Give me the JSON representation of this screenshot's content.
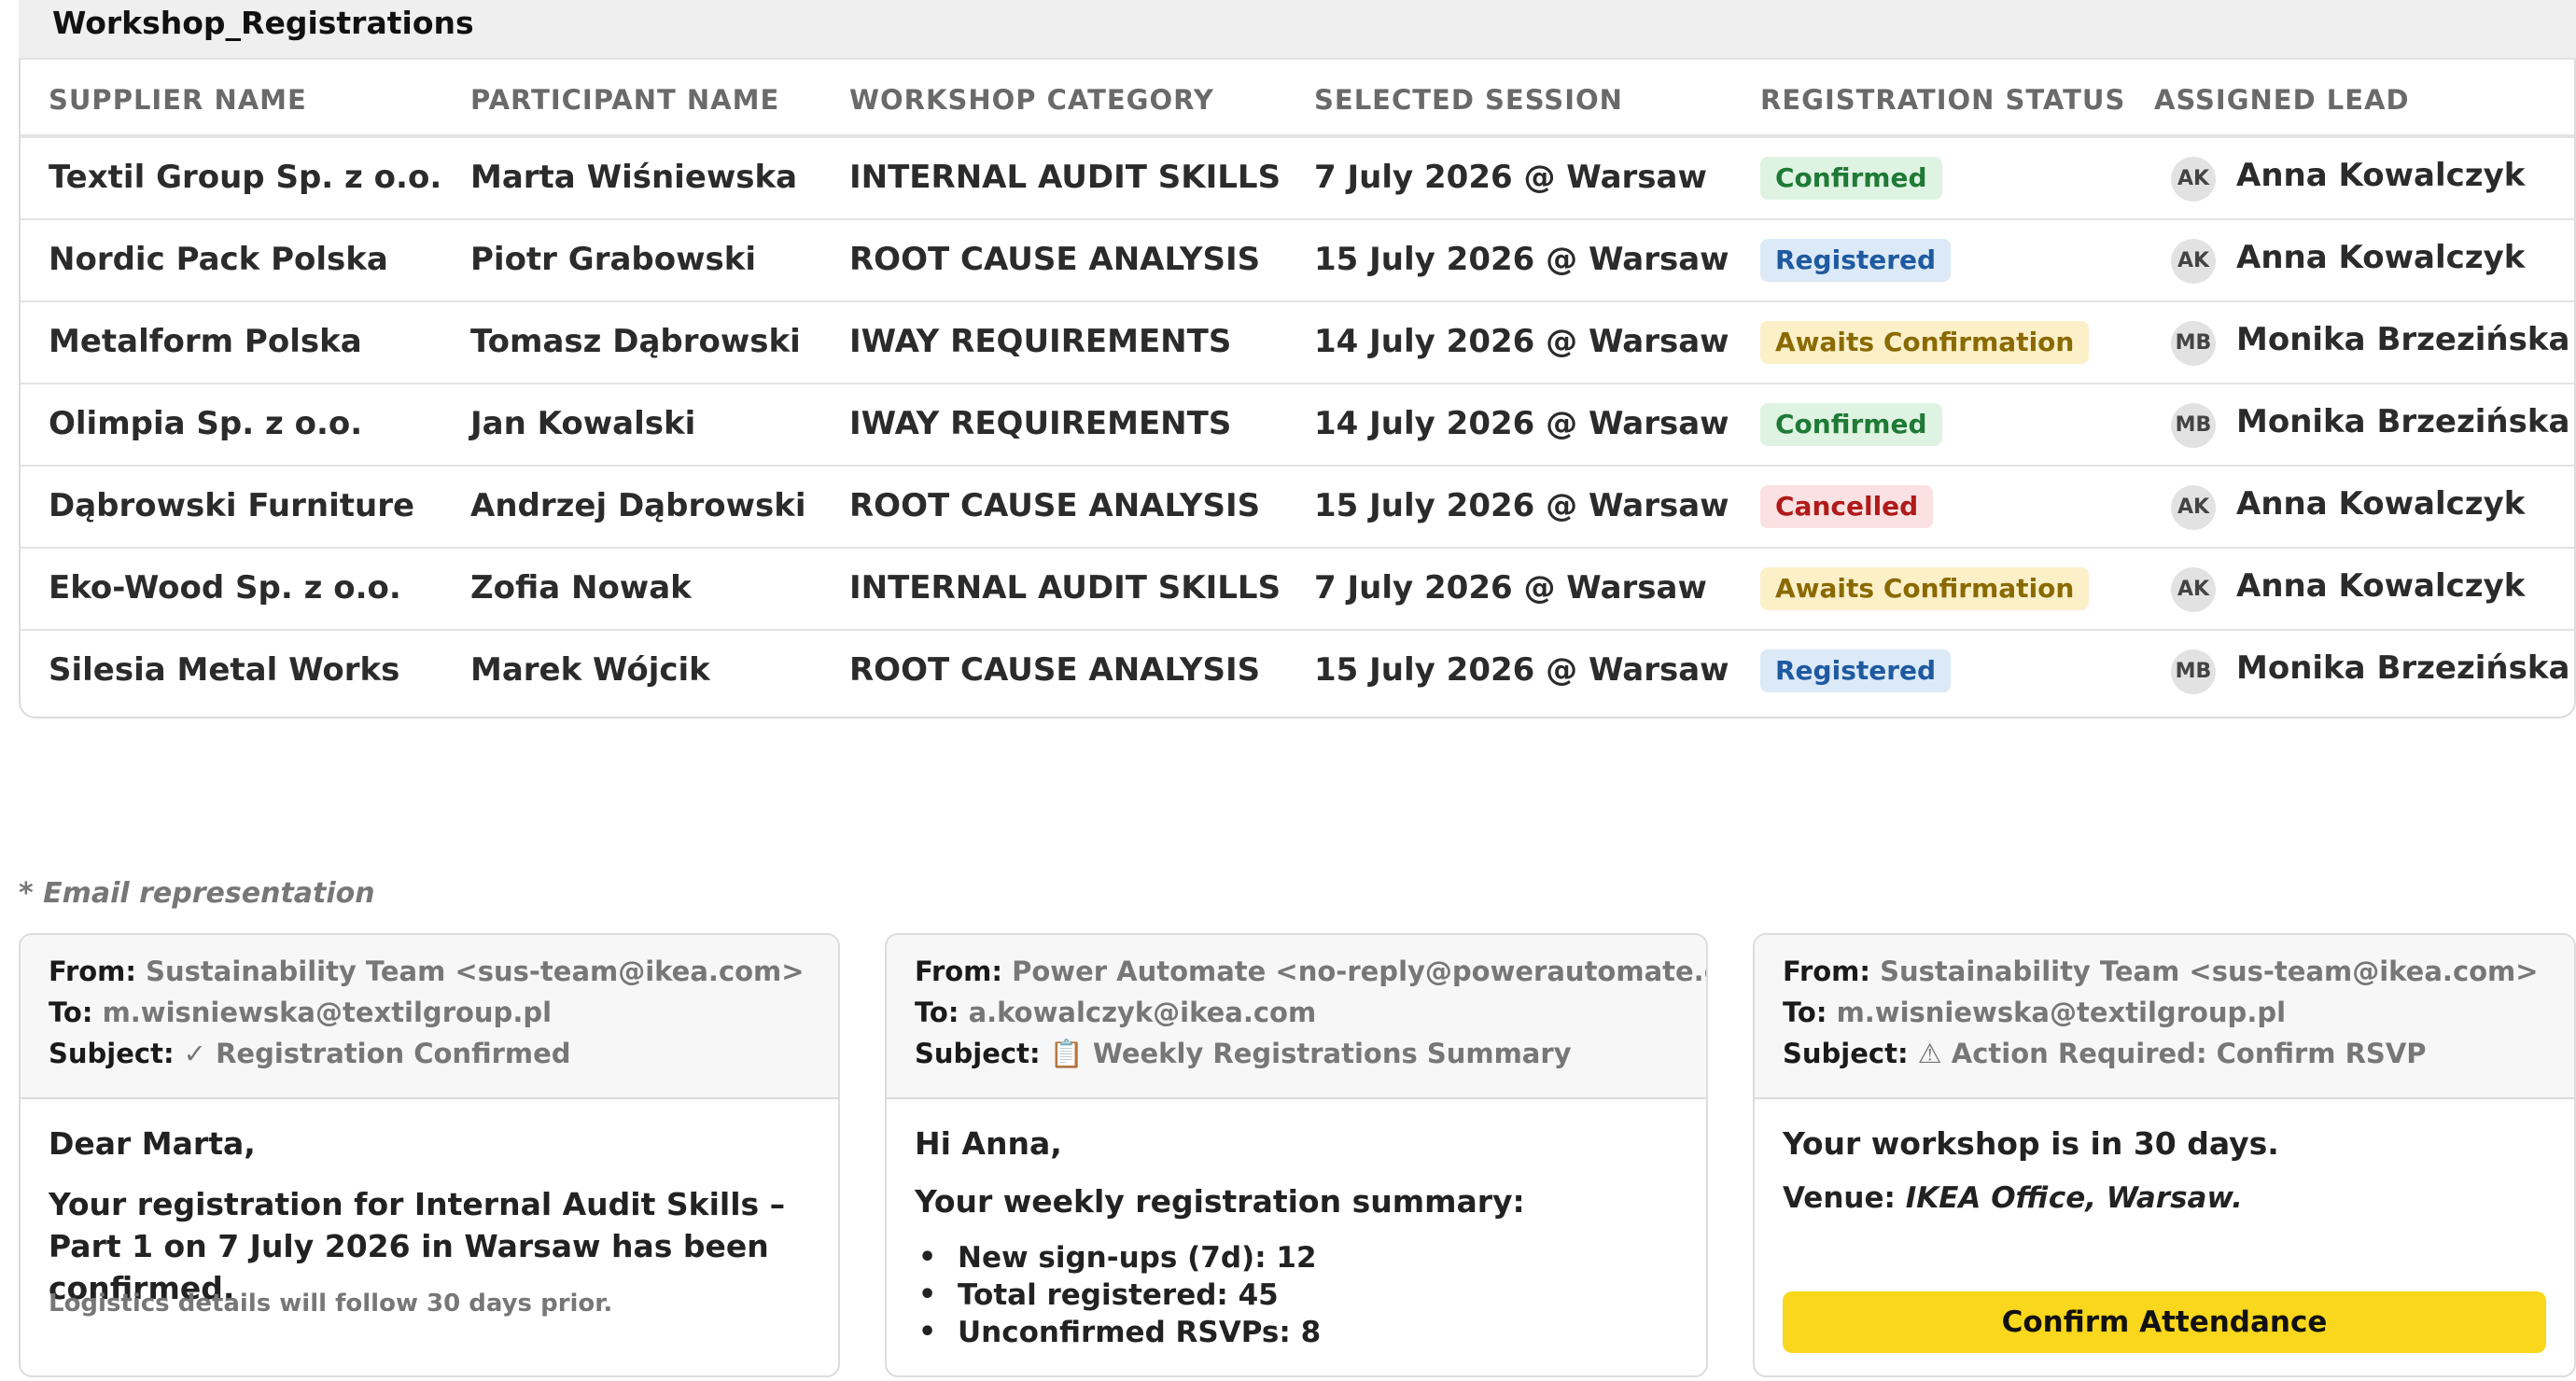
{
  "table": {
    "title": "Workshop_Registrations",
    "columns": [
      "SUPPLIER NAME",
      "PARTICIPANT NAME",
      "WORKSHOP CATEGORY",
      "SELECTED SESSION",
      "REGISTRATION STATUS",
      "ASSIGNED LEAD"
    ],
    "rows": [
      {
        "supplier": "Textil Group Sp. z o.o.",
        "participant": "Marta Wiśniewska",
        "category": "INTERNAL AUDIT SKILLS",
        "session": "7 July 2026 @ Warsaw",
        "status": "Confirmed",
        "status_color": "#1f7a35",
        "lead_initials": "AK",
        "lead": "Anna Kowalczyk"
      },
      {
        "supplier": "Nordic Pack Polska",
        "participant": "Piotr Grabowski",
        "category": "ROOT CAUSE ANALYSIS",
        "session": "15 July 2026 @ Warsaw",
        "status": "Registered",
        "status_color": "#1e5aa0",
        "lead_initials": "AK",
        "lead": "Anna Kowalczyk"
      },
      {
        "supplier": "Metalform Polska",
        "participant": "Tomasz Dąbrowski",
        "category": "IWAY REQUIREMENTS",
        "session": "14 July 2026 @ Warsaw",
        "status": "Awaits Confirmation",
        "status_color": "#8a6a00",
        "lead_initials": "MB",
        "lead": "Monika Brzezińska"
      },
      {
        "supplier": "Olimpia Sp. z o.o.",
        "participant": "Jan Kowalski",
        "category": "IWAY REQUIREMENTS",
        "session": "14 July 2026 @ Warsaw",
        "status": "Confirmed",
        "status_color": "#1f7a35",
        "lead_initials": "MB",
        "lead": "Monika Brzezińska"
      },
      {
        "supplier": "Dąbrowski Furniture",
        "participant": "Andrzej Dąbrowski",
        "category": "ROOT CAUSE ANALYSIS",
        "session": "15 July 2026 @ Warsaw",
        "status": "Cancelled",
        "status_color": "#b01a1a",
        "lead_initials": "AK",
        "lead": "Anna Kowalczyk"
      },
      {
        "supplier": "Eko-Wood Sp. z o.o.",
        "participant": "Zofia Nowak",
        "category": "INTERNAL AUDIT SKILLS",
        "session": "7 July 2026 @ Warsaw",
        "status": "Awaits Confirmation",
        "status_color": "#8a6a00",
        "lead_initials": "AK",
        "lead": "Anna Kowalczyk"
      },
      {
        "supplier": "Silesia Metal Works",
        "participant": "Marek Wójcik",
        "category": "ROOT CAUSE ANALYSIS",
        "session": "15 July 2026 @ Warsaw",
        "status": "Registered",
        "status_color": "#1e5aa0",
        "lead_initials": "MB",
        "lead": "Monika Brzezińska"
      }
    ]
  },
  "email_caption": "* Email representation",
  "emails": {
    "labels": {
      "from": "From:",
      "to": "To:",
      "subject": "Subject:"
    },
    "confirmation": {
      "from": "Sustainability Team <sus-team@ikea.com>",
      "to": "m.wisniewska@textilgroup.pl",
      "subject": "✓ Registration Confirmed",
      "greeting": "Dear Marta,",
      "body": "Your registration for Internal Audit Skills – Part 1 on 7 July 2026 in Warsaw has been confirmed.",
      "note": "Logistics details will follow 30 days prior."
    },
    "summary": {
      "from": "Power Automate <no-reply@powerautomate.com>",
      "to": "a.kowalczyk@ikea.com",
      "subject": "📋 Weekly Registrations Summary",
      "greeting": "Hi Anna,",
      "intro": "Your weekly registration summary:",
      "stats": [
        "New sign-ups (7d): 12",
        "Total registered: 45",
        "Unconfirmed RSVPs: 8"
      ]
    },
    "rsvp": {
      "from": "Sustainability Team <sus-team@ikea.com>",
      "to": "m.wisniewska@textilgroup.pl",
      "subject": "⚠ Action Required: Confirm RSVP",
      "headline": "Your workshop is in 30 days.",
      "venue_label": "Venue:",
      "venue": "IKEA Office, Warsaw.",
      "button_label": "Confirm Attendance",
      "button_color": "#f9d71c"
    }
  }
}
